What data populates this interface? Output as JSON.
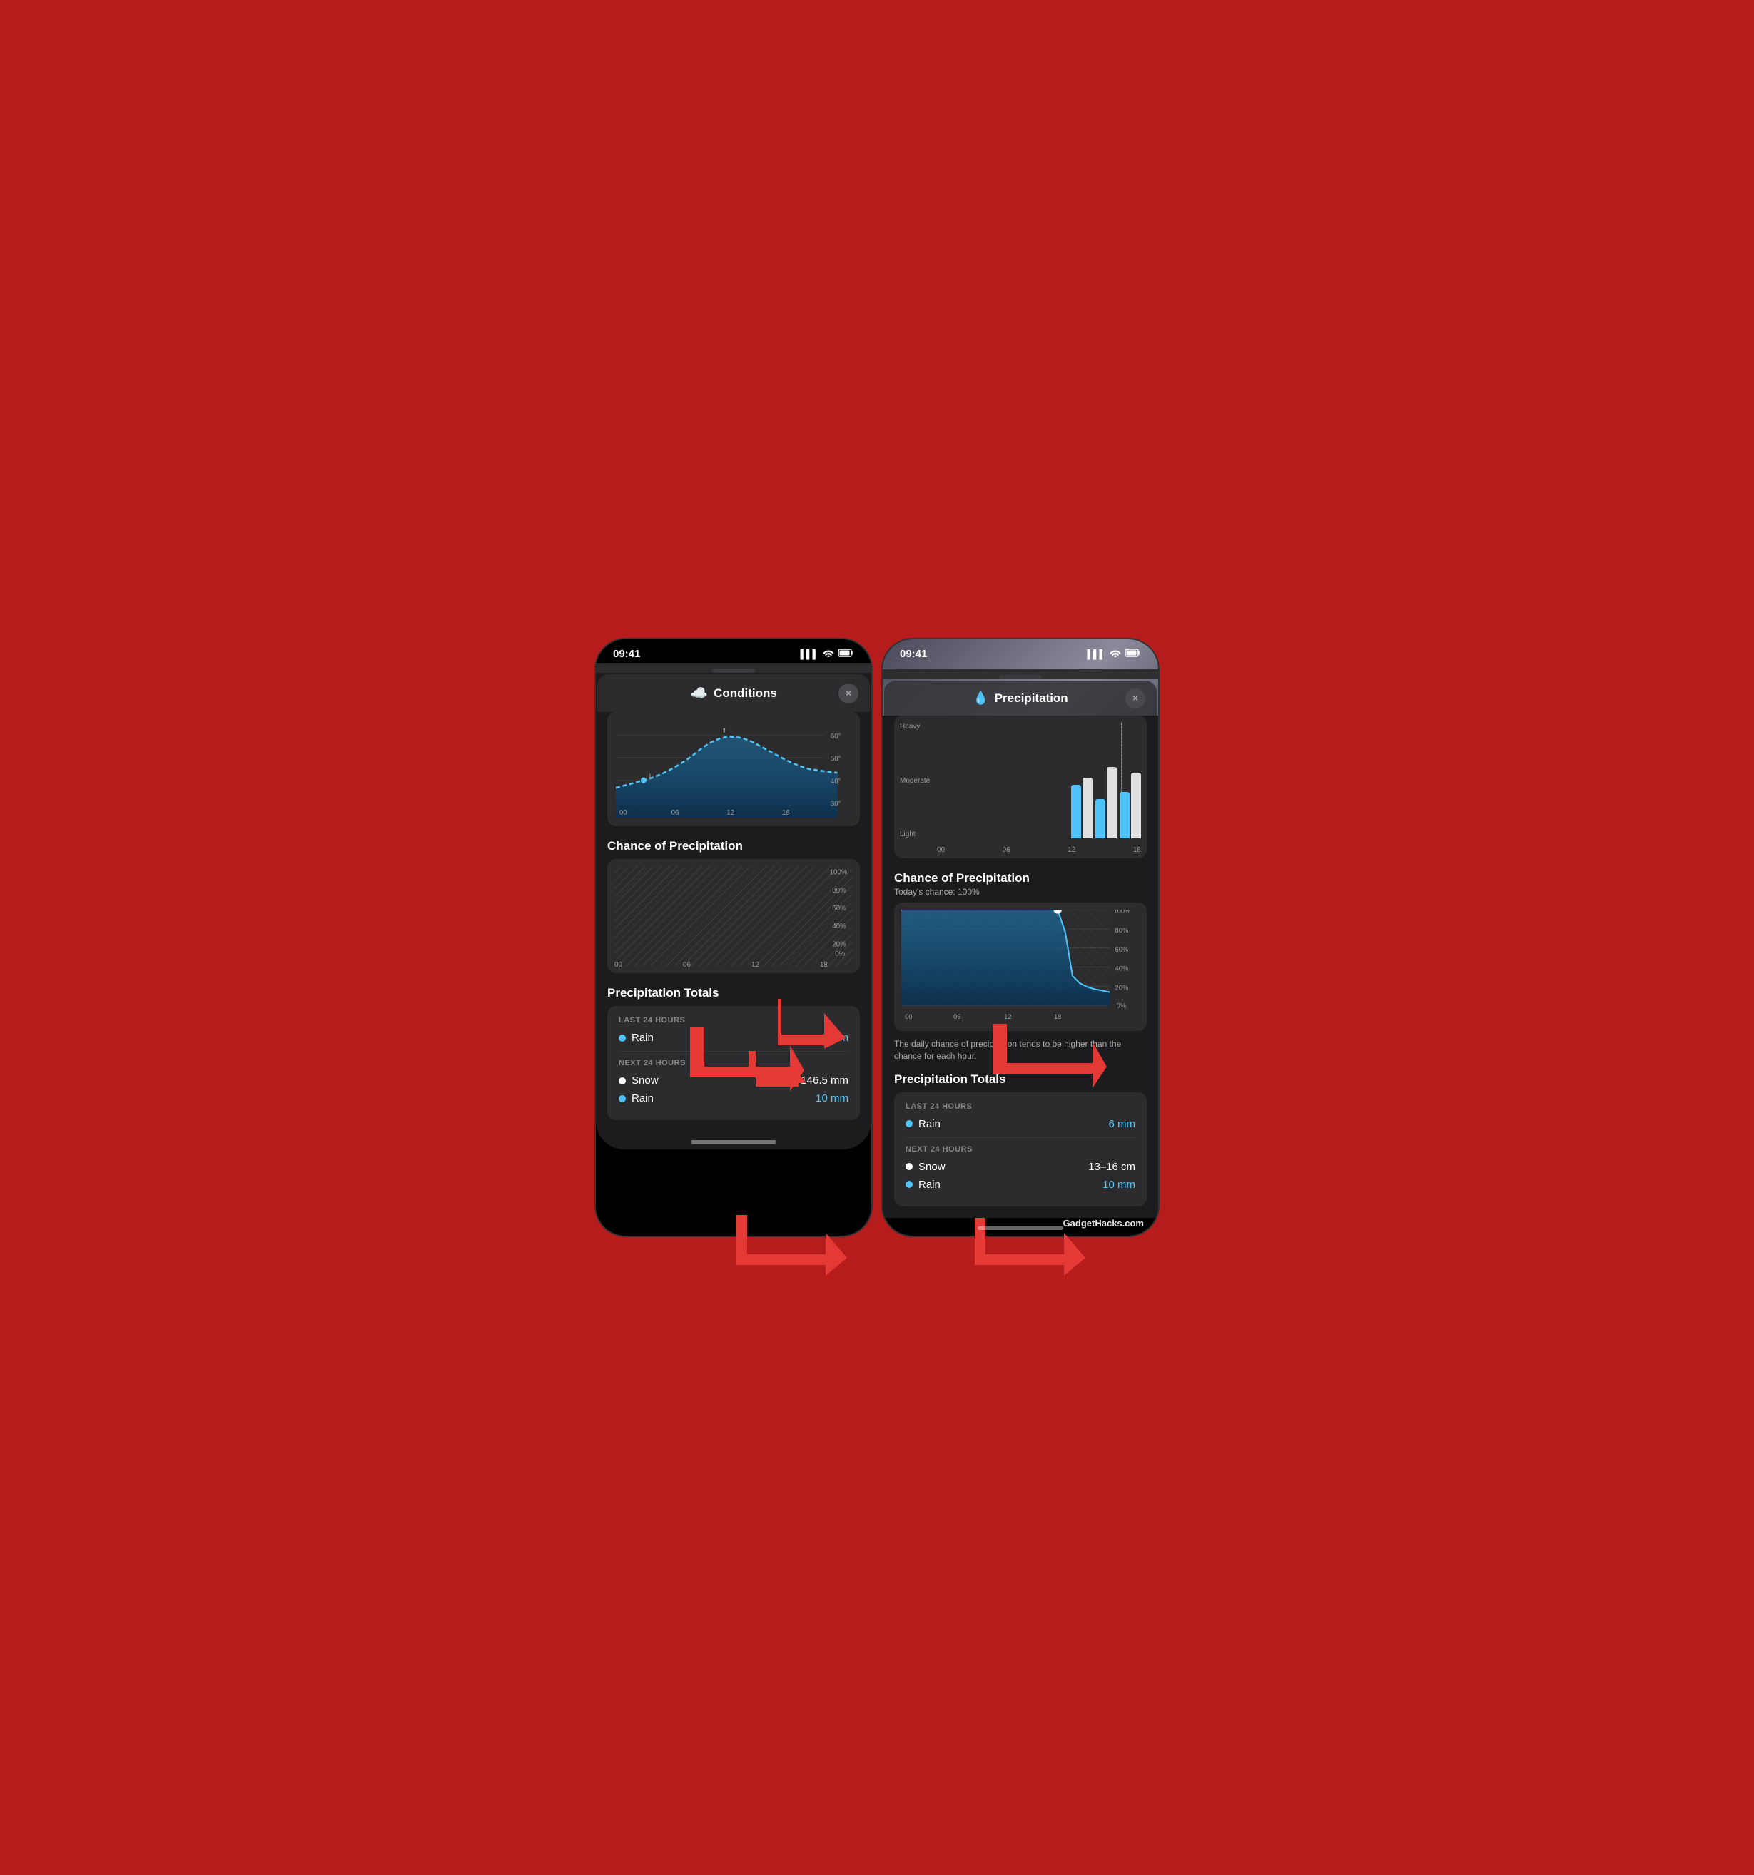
{
  "background_color": "#b71c1c",
  "watermark": "GadgetHacks.com",
  "left_phone": {
    "status_bar": {
      "time": "09:41",
      "signal": "▌▌▌",
      "wifi": "wifi",
      "battery": "battery"
    },
    "modal": {
      "title": "Conditions",
      "title_icon": "cloud",
      "close_label": "×",
      "temp_chart": {
        "y_labels": [
          "60°",
          "50°",
          "40°",
          "30°"
        ],
        "x_labels": [
          "00",
          "06",
          "12",
          "18"
        ]
      },
      "chance_of_precip_title": "Chance of Precipitation",
      "precip_chance_chart": {
        "y_labels": [
          "100%",
          "80%",
          "60%",
          "40%",
          "20%",
          "0%"
        ],
        "x_labels": [
          "00",
          "06",
          "12",
          "18"
        ]
      },
      "precip_totals_title": "Precipitation Totals",
      "last_24_label": "LAST 24 HOURS",
      "rain_label": "Rain",
      "rain_value": "6 mm",
      "next_24_label": "NEXT 24 HOURS",
      "snow_label": "Snow",
      "snow_value": "146.5 mm",
      "rain2_label": "Rain",
      "rain2_value": "10 mm"
    }
  },
  "right_phone": {
    "status_bar": {
      "time": "09:41",
      "signal": "▌▌▌",
      "wifi": "wifi",
      "battery": "battery"
    },
    "modal": {
      "title": "Precipitation",
      "title_icon": "drop",
      "close_label": "×",
      "bar_chart": {
        "y_labels": [
          "Heavy",
          "Moderate",
          "Light"
        ],
        "x_labels": [
          "00",
          "06",
          "12",
          "18"
        ],
        "bars": [
          {
            "blue": 65,
            "white": 70
          },
          {
            "blue": 45,
            "white": 90
          },
          {
            "blue": 55,
            "white": 85
          }
        ]
      },
      "chance_of_precip_title": "Chance of Precipitation",
      "todays_chance": "Today's chance: 100%",
      "precip_chart": {
        "y_labels": [
          "100%",
          "80%",
          "60%",
          "40%",
          "20%",
          "0%"
        ],
        "x_labels": [
          "00",
          "06",
          "12",
          "18"
        ]
      },
      "note_text": "The daily chance of precipitation tends to be higher than the chance for each hour.",
      "precip_totals_title": "Precipitation Totals",
      "last_24_label": "LAST 24 HOURS",
      "rain_label": "Rain",
      "rain_value": "6 mm",
      "next_24_label": "NEXT 24 HOURS",
      "snow_label": "Snow",
      "snow_value": "13–16 cm",
      "rain2_label": "Rain",
      "rain2_value": "10 mm"
    }
  }
}
